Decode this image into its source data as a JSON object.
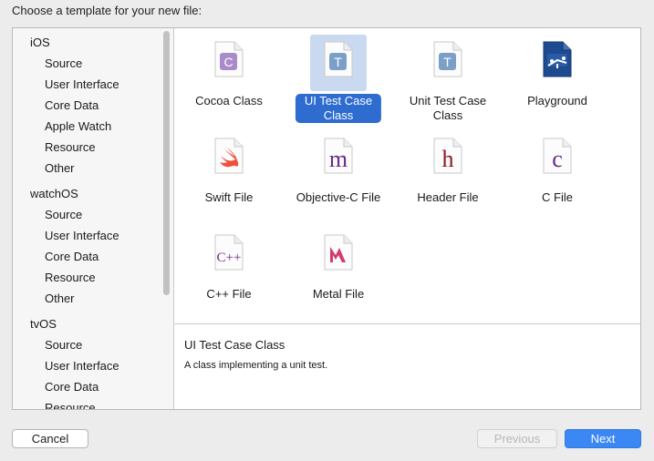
{
  "header": {
    "title": "Choose a template for your new file:"
  },
  "sidebar": {
    "platforms": [
      {
        "label": "iOS",
        "items": [
          "Source",
          "User Interface",
          "Core Data",
          "Apple Watch",
          "Resource",
          "Other"
        ]
      },
      {
        "label": "watchOS",
        "items": [
          "Source",
          "User Interface",
          "Core Data",
          "Resource",
          "Other"
        ]
      },
      {
        "label": "tvOS",
        "items": [
          "Source",
          "User Interface",
          "Core Data",
          "Resource"
        ]
      }
    ]
  },
  "templates": [
    {
      "line1": "Cocoa Class",
      "line2": "",
      "icon": "cocoa-class-icon",
      "glyph": "C",
      "selected": false
    },
    {
      "line1": "UI Test Case",
      "line2": "Class",
      "icon": "ui-test-case-class-icon",
      "glyph": "T",
      "selected": true
    },
    {
      "line1": "Unit Test Case",
      "line2": "Class",
      "icon": "unit-test-case-class-icon",
      "glyph": "T",
      "selected": false
    },
    {
      "line1": "Playground",
      "line2": "",
      "icon": "playground-icon",
      "glyph": "",
      "selected": false
    },
    {
      "line1": "Swift File",
      "line2": "",
      "icon": "swift-file-icon",
      "glyph": "",
      "selected": false
    },
    {
      "line1": "Objective-C File",
      "line2": "",
      "icon": "objective-c-file-icon",
      "glyph": "m",
      "selected": false
    },
    {
      "line1": "Header File",
      "line2": "",
      "icon": "header-file-icon",
      "glyph": "h",
      "selected": false
    },
    {
      "line1": "C File",
      "line2": "",
      "icon": "c-file-icon",
      "glyph": "c",
      "selected": false
    },
    {
      "line1": "C++ File",
      "line2": "",
      "icon": "cpp-file-icon",
      "glyph": "C++",
      "selected": false
    },
    {
      "line1": "Metal File",
      "line2": "",
      "icon": "metal-file-icon",
      "glyph": "",
      "selected": false
    }
  ],
  "description": {
    "title": "UI Test Case Class",
    "text": "A class implementing a unit test."
  },
  "buttons": {
    "cancel": "Cancel",
    "previous": "Previous",
    "next": "Next"
  },
  "colors": {
    "selection": "#2f6cd0",
    "accent": "#3b88f5",
    "objc_purple": "#6a2b87",
    "header_maroon": "#8b1a2a",
    "swift_orange": "#f05138"
  }
}
